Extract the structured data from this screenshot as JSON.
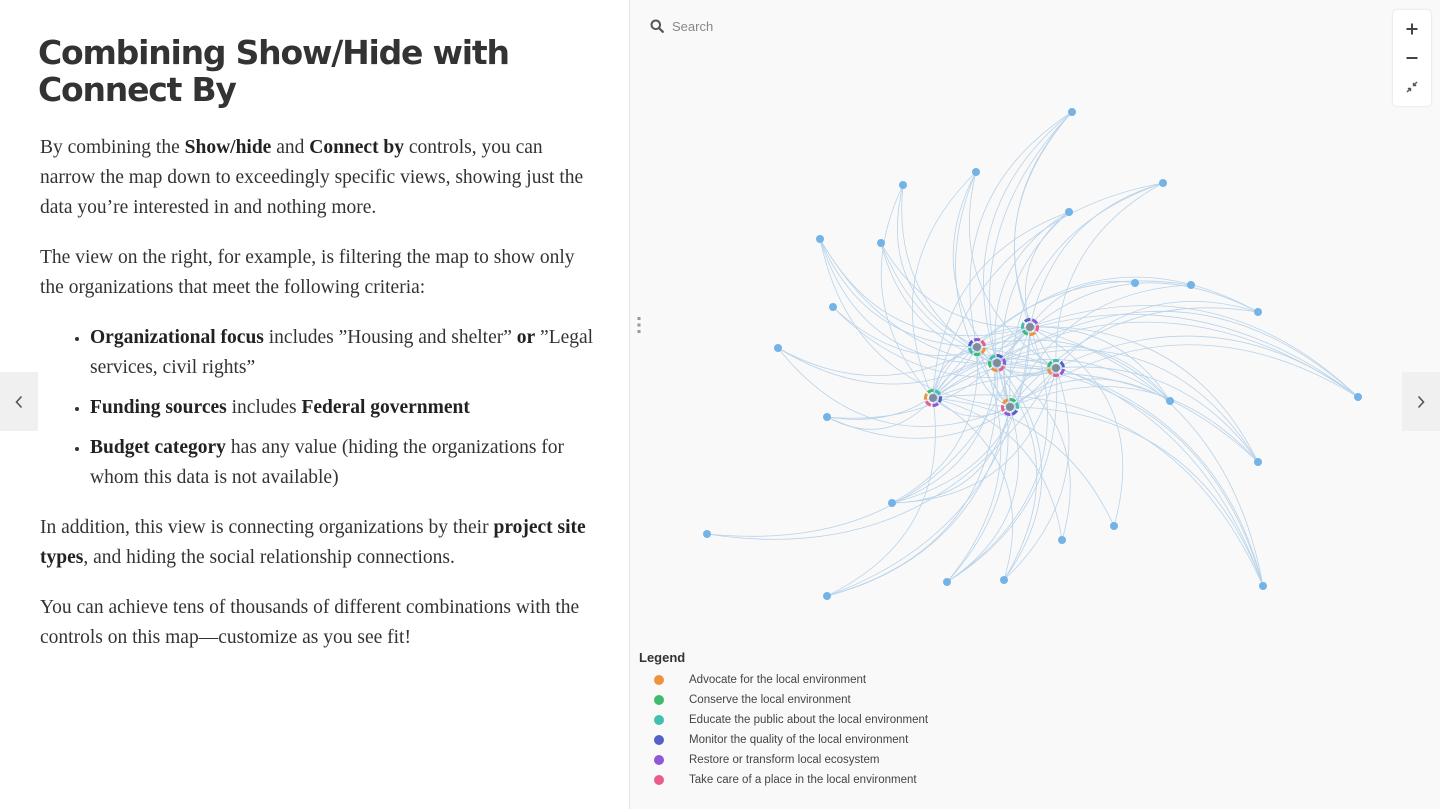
{
  "article": {
    "title": "Combining Show/Hide with Connect By",
    "p1": {
      "a": "By combining the ",
      "b": "Show/hide",
      "c": " and ",
      "d": "Connect by",
      "e": " controls, you can narrow the map down to exceedingly specific views, showing just the data you’re interested in and nothing more."
    },
    "p2": "The view on the right, for example, is filtering the map to show only the organizations that meet the following criteria:",
    "list": [
      {
        "a": "Organizational focus",
        "b": " includes ”Housing and shelter” ",
        "c": "or",
        "d": " ”Legal services, civil rights”"
      },
      {
        "a": "Funding sources",
        "b": " includes ",
        "c": "Federal government"
      },
      {
        "a": "Budget category",
        "b": " has any value (hiding the organizations for whom this data is not available)"
      }
    ],
    "p3": {
      "a": "In addition, this view is connecting organizations by their ",
      "b": "project site types",
      "c": ", and hiding the social relationship connections."
    },
    "p4": "You can achieve tens of thousands of different combinations with the controls on this map—customize as you see fit!"
  },
  "map": {
    "search": {
      "placeholder": "Search",
      "icon": "search-icon"
    },
    "zoom": {
      "in_icon": "plus-icon",
      "out_icon": "minus-icon",
      "fit_icon": "collapse-icon"
    },
    "node_color": "#74b3e6",
    "edge_color": "#b9d3ea",
    "legend": {
      "title": "Legend",
      "items": [
        {
          "label": "Advocate for the local environment",
          "color": "#f0923d"
        },
        {
          "label": "Conserve the local environment",
          "color": "#3dbb6e"
        },
        {
          "label": "Educate the public about the local environment",
          "color": "#42bfae"
        },
        {
          "label": "Monitor the quality of the local environment",
          "color": "#5560c6"
        },
        {
          "label": "Restore or transform local ecosystem",
          "color": "#8e58d9"
        },
        {
          "label": "Take care of a place in the local environment",
          "color": "#ea5b8f"
        }
      ]
    }
  },
  "nav": {
    "prev_icon": "chevron-left-icon",
    "next_icon": "chevron-right-icon"
  }
}
